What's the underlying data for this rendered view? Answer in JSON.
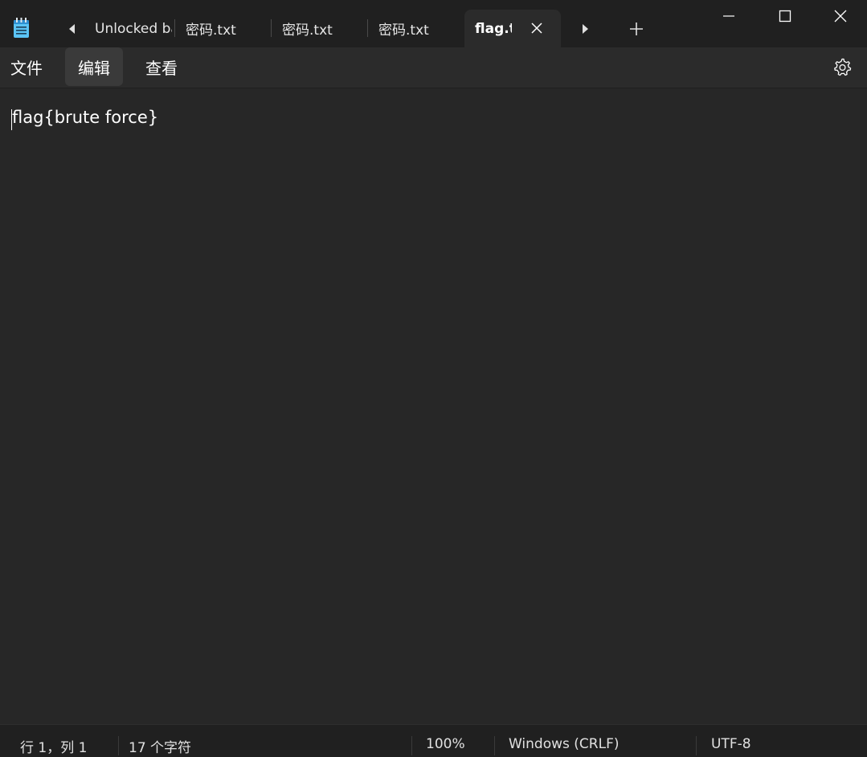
{
  "titlebar": {
    "tabs": [
      {
        "label": "Unlocked ba"
      },
      {
        "label": "密码.txt"
      },
      {
        "label": "密码.txt"
      },
      {
        "label": "密码.txt"
      },
      {
        "label": "flag.t"
      }
    ],
    "icons": {
      "app": "notepad-icon",
      "scroll_left": "chevron-left-icon",
      "scroll_right": "chevron-right-icon",
      "new_tab": "plus-icon",
      "close_tab": "close-icon",
      "minimize": "minimize-icon",
      "maximize": "maximize-icon",
      "close_window": "close-icon"
    }
  },
  "menu": {
    "file": "文件",
    "edit": "编辑",
    "view": "查看",
    "settings_icon": "gear-icon"
  },
  "editor": {
    "content": "flag{brute force}"
  },
  "statusbar": {
    "position": "行 1，列 1",
    "char_count": "17 个字符",
    "zoom": "100%",
    "line_ending": "Windows (CRLF)",
    "encoding": "UTF-8"
  },
  "colors": {
    "titlebar_bg": "#202020",
    "menubar_bg": "#2b2b2b",
    "editor_bg": "#272727",
    "statusbar_bg": "#202020",
    "app_icon_accent": "#4cc2ff"
  }
}
